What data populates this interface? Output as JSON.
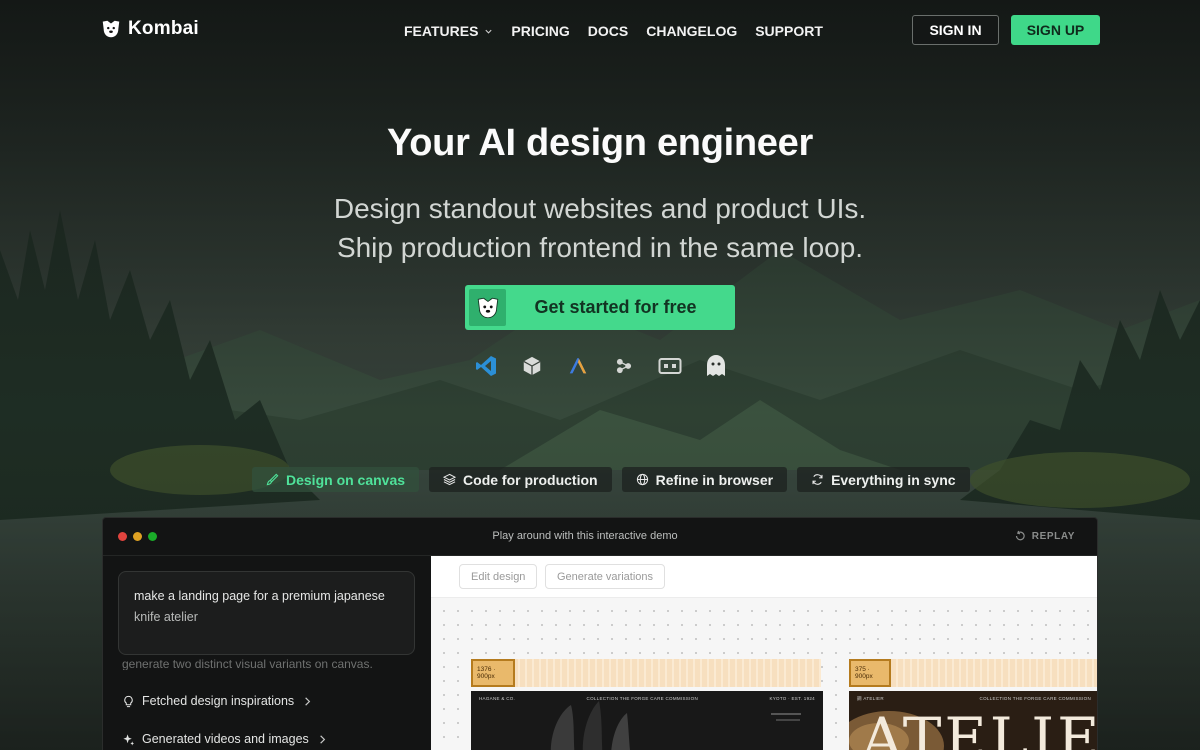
{
  "nav": {
    "brand": "Kombai",
    "links": [
      {
        "label": "FEATURES",
        "has_dropdown": true
      },
      {
        "label": "PRICING",
        "has_dropdown": false
      },
      {
        "label": "DOCS",
        "has_dropdown": false
      },
      {
        "label": "CHANGELOG",
        "has_dropdown": false
      },
      {
        "label": "SUPPORT",
        "has_dropdown": false
      }
    ],
    "sign_in": "SIGN IN",
    "sign_up": "SIGN UP"
  },
  "hero": {
    "title": "Your AI design engineer",
    "subtitle_line1": "Design standout websites and product UIs.",
    "subtitle_line2": "Ship production frontend in the same loop.",
    "cta_label": "Get started for free"
  },
  "integrations": [
    "vscode-icon",
    "cube-icon",
    "antigravity-icon",
    "nodes-icon",
    "terminal-icon",
    "ghost-icon"
  ],
  "feature_tabs": [
    {
      "label": "Design on canvas",
      "icon": "brush-icon",
      "active": true
    },
    {
      "label": "Code for production",
      "icon": "layers-icon",
      "active": false
    },
    {
      "label": "Refine in browser",
      "icon": "globe-icon",
      "active": false
    },
    {
      "label": "Everything in sync",
      "icon": "sync-icon",
      "active": false
    }
  ],
  "demo": {
    "caption": "Play around with this interactive demo",
    "replay": "REPLAY",
    "prompt_line1": "make a landing page for a premium japanese",
    "prompt_line2": "knife atelier",
    "faded_text": "generate two distinct visual variants on canvas.",
    "steps": [
      {
        "label": "Fetched design inspirations",
        "icon": "bulb-icon"
      },
      {
        "label": "Generated videos and images",
        "icon": "sparkle-icon"
      }
    ],
    "toolbar": {
      "edit": "Edit design",
      "variations": "Generate variations"
    },
    "frames": [
      {
        "tag": "1376 · 900px",
        "brand": "HAGANE & CO.",
        "links": "COLLECTION    THE FORGE    CARE    COMMISSION",
        "right": "KYOTO · EST. 1924"
      },
      {
        "tag": "375 · 900px",
        "brand": "鋼 ATELIER",
        "links": "COLLECTION    THE FORGE    CARE    COMMISSION",
        "headline": "ATELIE"
      }
    ]
  },
  "colors": {
    "accent": "#3fd889",
    "accent_dark": "#2fb06d",
    "window_bg": "#131414",
    "dot_red": "#e0443e",
    "dot_yellow": "#dea123",
    "dot_green": "#1aab29"
  }
}
